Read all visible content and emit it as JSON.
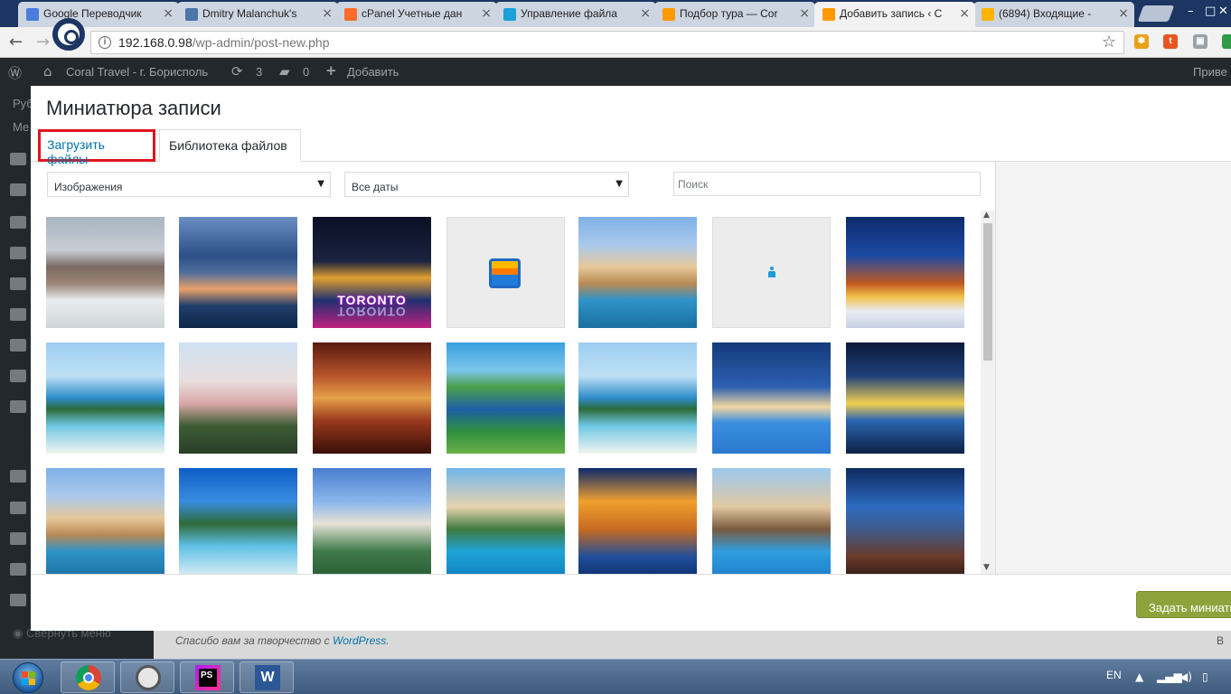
{
  "browser": {
    "tabs": [
      {
        "title": "Google Переводчик",
        "favicon": "google-translate",
        "color": "#4a7ede"
      },
      {
        "title": "Dmitry Malanchuk's",
        "favicon": "vk",
        "color": "#4a76a8"
      },
      {
        "title": "cPanel Учетные дан",
        "favicon": "cpanel",
        "color": "#ff6c2c"
      },
      {
        "title": "Управление файла",
        "favicon": "iq",
        "color": "#1ca0d8"
      },
      {
        "title": "Подбор тура — Cor",
        "favicon": "coral",
        "color": "#ff9900"
      },
      {
        "title": "Добавить запись ‹ C",
        "favicon": "coral",
        "color": "#ff9900",
        "active": true
      },
      {
        "title": "(6894) Входящие - ",
        "favicon": "mail",
        "color": "#ffb400"
      }
    ],
    "window_controls": [
      "–",
      "□",
      "✕"
    ],
    "url_host": "192.168.0.98",
    "url_path": "/wp-admin/post-new.php"
  },
  "adminbar": {
    "site_name": "Coral Travel - г. Борисполь",
    "updates_count": "3",
    "comments_count": "0",
    "add_label": "Добавить",
    "greeting": "Приве"
  },
  "sidemenu": {
    "collapse_label": "Свернуть меню",
    "partial_labels": [
      "Руб",
      "Ме"
    ]
  },
  "footer": {
    "text": "Спасибо вам за творчество с ",
    "link": "WordPress",
    "suffix": ".",
    "right": "В"
  },
  "modal": {
    "title": "Миниатюра записи",
    "tabs": {
      "upload": "Загрузить файлы",
      "library": "Библиотека файлов"
    },
    "filter_type": "Изображения",
    "filter_date": "Все даты",
    "search_placeholder": "Поиск",
    "submit_label": "Задать миниатюру",
    "thumbnails": [
      {
        "name": "waterfall-city",
        "kind": "photo",
        "bg": "linear-gradient(#a9b5c2 0%, #c7cdd4 30%, #7a6a62 45%, #9b8577 60%, #e9ecee 75%, #cfd5d8 100%)"
      },
      {
        "name": "vancouver-harbor",
        "kind": "photo",
        "bg": "linear-gradient(#6b8fc4 0%, #2c4f86 35%, #4f6f9c 50%, #e9a06a 65%, #1f3e6b 80%, #0f2748 100%)"
      },
      {
        "name": "toronto-night",
        "kind": "photo",
        "bg": "linear-gradient(#0a0f24 0%, #1b2340 40%, #e0a030 55%, #203070 75%, #c02080 100%)",
        "text": "TORONTO"
      },
      {
        "name": "coral-logo",
        "kind": "logo"
      },
      {
        "name": "resort-pool-1",
        "kind": "photo",
        "bg": "linear-gradient(#7fb0e6 0%, #a9c9ec 25%, #e6c89a 45%, #b88a54 60%, #2f93c9 75%, #1a6f9e 100%)"
      },
      {
        "name": "blank-person",
        "kind": "person"
      },
      {
        "name": "winter-village",
        "kind": "photo",
        "bg": "linear-gradient(#0d2b6b 0%, #1c4aa3 35%, #c05a20 60%, #f2c14a 72%, #e8ecf5 85%, #c6d0e2 100%)"
      },
      {
        "name": "maldives-1",
        "kind": "photo",
        "bg": "linear-gradient(#9ccdf0 0%, #bfe0f5 30%, #2e8cc9 50%, #2d6b3a 60%, #6ec8e5 75%, #f2f4ef 100%)"
      },
      {
        "name": "disney-castle",
        "kind": "photo",
        "bg": "linear-gradient(#cfe1f2 0%, #e9dedd 35%, #d9a7a8 55%, #3d5c34 75%, #2a3f28 100%)"
      },
      {
        "name": "ornate-facade",
        "kind": "photo",
        "bg": "linear-gradient(#5a1a10 0%, #b8542a 30%, #e6a04a 50%, #9b3a1e 70%, #3a0f08 100%)"
      },
      {
        "name": "golf-island",
        "kind": "photo",
        "bg": "linear-gradient(#38a0e0 0%, #7cc6ec 25%, #4aa04a 40%, #1d5fa6 60%, #2f8f3e 80%, #6ab04a 100%)"
      },
      {
        "name": "maldives-2",
        "kind": "photo",
        "bg": "linear-gradient(#9ccdf0 0%, #bfe0f5 30%, #2e8cc9 50%, #2d6b3a 60%, #6ec8e5 75%, #f2f4ef 100%)"
      },
      {
        "name": "night-pool",
        "kind": "photo",
        "bg": "linear-gradient(#143a7a 0%, #2c5fb0 40%, #f0d7a0 58%, #3b8fe0 72%, #2a78d0 100%)"
      },
      {
        "name": "palm-sunset",
        "kind": "photo",
        "bg": "linear-gradient(#0b1a3a 0%, #1d3f7a 30%, #f2d050 55%, #2a66b0 70%, #0d2246 100%)"
      },
      {
        "name": "resort-pool-2",
        "kind": "photo",
        "bg": "linear-gradient(#7fb0e6 0%, #a9c9ec 25%, #e6c89a 45%, #b88a54 60%, #2f93c9 75%, #1a6f9e 100%)"
      },
      {
        "name": "tropical-beach",
        "kind": "photo",
        "bg": "linear-gradient(#0e5ec6 0%, #3a8de0 30%, #2f6a3a 50%, #5fc0e6 70%, #e6f2f5 100%)"
      },
      {
        "name": "dubai-burj",
        "kind": "photo",
        "bg": "linear-gradient(#4a7fd0 0%, #8ab6ea 30%, #e6e2d6 50%, #3f7a4a 75%, #2a5a34 100%)"
      },
      {
        "name": "hotel-pool-1",
        "kind": "photo",
        "bg": "linear-gradient(#6fb5ea 0%, #e8d4b0 35%, #3e7a3e 55%, #20a4d8 75%, #0f7fbf 100%)"
      },
      {
        "name": "hotel-night",
        "kind": "photo",
        "bg": "linear-gradient(#0d2a6a 0%, #f0a030 30%, #c86a20 55%, #1f4f9a 80%, #0d2e6a 100%)"
      },
      {
        "name": "hotel-pool-2",
        "kind": "photo",
        "bg": "linear-gradient(#9cc9ee 0%, #e2c9a2 35%, #7a5a3e 55%, #2f9ee0 75%, #1e7ec8 100%)"
      },
      {
        "name": "paris-terrace",
        "kind": "photo",
        "bg": "linear-gradient(#0f2a60 0%, #2d6bc0 35%, #3f5a8a 55%, #6b3a2a 80%, #2a1a14 100%)"
      }
    ]
  },
  "taskbar": {
    "lang": "EN",
    "apps": [
      "chrome",
      "camtasia",
      "phpstorm",
      "word"
    ]
  },
  "colors": {
    "wp_dark": "#23282d",
    "link": "#0073aa",
    "highlight_red": "#e0151f",
    "button_green": "#8fa33c",
    "browser_frame": "#1c3563"
  }
}
